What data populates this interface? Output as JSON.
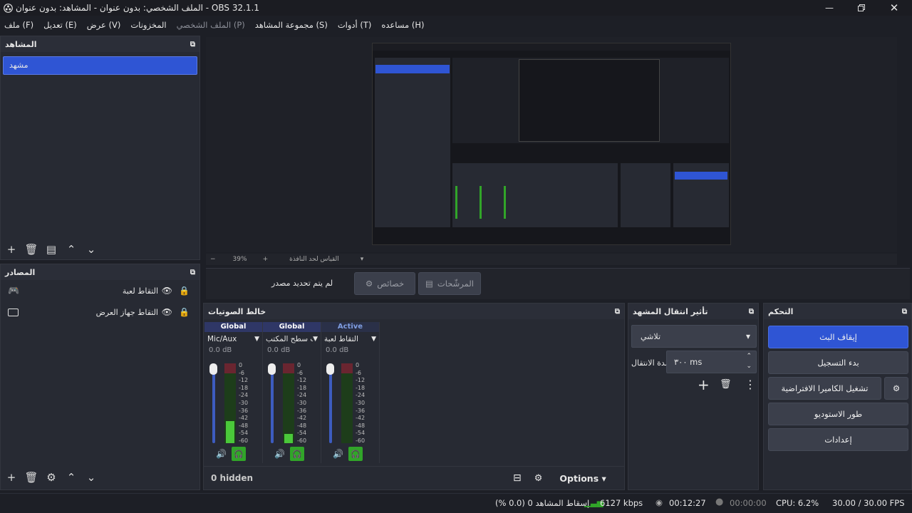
{
  "window": {
    "title": "OBS 32.1.1 - الملف الشخصي: بدون عنوان - المشاهد: بدون عنوان"
  },
  "menu": [
    "ملف (F)",
    "تعديل (E)",
    "عرض (V)",
    "المخزونات",
    "الملف الشخصي (P)",
    "مجموعة المشاهد (S)",
    "أدوات (T)",
    "مساعده (H)"
  ],
  "scenes": {
    "title": "المشاهد",
    "items": [
      "مشهد"
    ]
  },
  "sources": {
    "title": "المصادر",
    "items": [
      {
        "name": "التقاط لعبة",
        "icon": "gamepad-icon"
      },
      {
        "name": "التقاط جهاز العرض",
        "icon": "monitor-icon"
      }
    ]
  },
  "preview": {
    "zoom": "39%",
    "scale_label": "القياس لحد النافذة"
  },
  "source_bar": {
    "no_source": "لم يتم تحديد مصدر",
    "properties": "خصائص",
    "filters": "المرشّحات"
  },
  "mixer": {
    "title": "خالط الصوتيات",
    "hidden": "0 hidden",
    "options": "Options",
    "channels": [
      {
        "mode": "Global",
        "name": "Mic/Aux",
        "db": "0.0 dB",
        "level": 0.28
      },
      {
        "mode": "Global",
        "name": "صوت سطح المكتب",
        "db": "0.0 dB",
        "level": 0.12
      },
      {
        "mode": "Active",
        "name": "التقاط لعبة",
        "db": "0.0 dB",
        "level": 0.0
      }
    ],
    "ticks": [
      "0",
      "-6",
      "-12",
      "-18",
      "-24",
      "-30",
      "-36",
      "-42",
      "-48",
      "-54",
      "-60"
    ]
  },
  "transition": {
    "title": "تأثير انتقال المشهد",
    "type": "تلاشي",
    "duration_label": "مدة الانتقال",
    "duration": "٣٠٠ ms"
  },
  "controls": {
    "title": "التحكم",
    "stop_stream": "إيقاف البث",
    "record": "بدء التسجيل",
    "virtual_cam": "تشغيل الكاميرا الافتراضية",
    "studio": "طور الاستوديو",
    "settings": "إعدادات"
  },
  "status": {
    "dropped": "إسقاط المشاهد 0 (0.0 %)",
    "bitrate": "6127 kbps",
    "stream_time": "00:12:27",
    "rec_time": "00:00:00",
    "cpu": "CPU: 6.2%",
    "fps": "30.00 / 30.00 FPS"
  },
  "colors": {
    "accent": "#2f55d4",
    "green": "#31a529",
    "panel": "#272a33"
  }
}
